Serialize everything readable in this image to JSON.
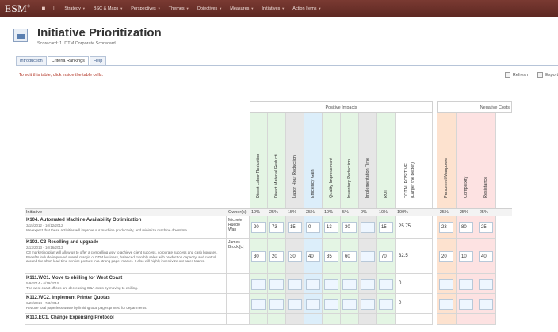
{
  "app": {
    "logo": "ESM",
    "logo_mark": "®",
    "nav": [
      "Strategy",
      "BSC & Maps",
      "Perspectives",
      "Themes",
      "Objectives",
      "Measures",
      "Initiatives",
      "Action Items"
    ]
  },
  "page": {
    "title": "Initiative Prioritization",
    "subtitle": "Scorecard: 1. DTM Corporate Scorecard"
  },
  "tabs": [
    "Introduction",
    "Criteria Rankings",
    "Help"
  ],
  "active_tab": 1,
  "instruction": "To edit this table, click inside the table cells.",
  "toolbar": {
    "refresh": "Refresh",
    "export": "Export"
  },
  "groups": {
    "positive": "Positive Impacts",
    "negative": "Negative Costs"
  },
  "criteria": [
    {
      "label": "Direct Labor Reduction",
      "weight": "10%",
      "color": "#e4f5e4"
    },
    {
      "label": "Direct Material Reducti...",
      "weight": "25%",
      "color": "#e4f5e4"
    },
    {
      "label": "Labor Hour Reduction",
      "weight": "15%",
      "color": "#e6e6e6"
    },
    {
      "label": "Efficiency Gain",
      "weight": "25%",
      "color": "#dceefa"
    },
    {
      "label": "Quality Improvement",
      "weight": "10%",
      "color": "#e4f5e4"
    },
    {
      "label": "Inventory Reduction",
      "weight": "5%",
      "color": "#e4f5e4"
    },
    {
      "label": "Implementation Time",
      "weight": "0%",
      "color": "#e6e6e6"
    },
    {
      "label": "ROI",
      "weight": "10%",
      "color": "#e4f5e4"
    }
  ],
  "total_positive": {
    "line1": "TOTAL POSITIVE",
    "line2": "(Larger the Better)",
    "weight": "100%"
  },
  "negative_criteria": [
    {
      "label": "Personnel/Manpower",
      "weight": "-25%",
      "color": "#fde2cf"
    },
    {
      "label": "Complexity",
      "weight": "-25%",
      "color": "#fde2e2"
    },
    {
      "label": "Resistance",
      "weight": "-25%",
      "color": "#fde2e2"
    }
  ],
  "headers": {
    "initiative": "Initiative",
    "owner": "Owner(s)"
  },
  "rows": [
    {
      "title": "K104. Automated Machine Availability Optimization",
      "date": "3/15/2012 - 10/12/2012",
      "desc": "We expect that these activities will improve our machine productivity, and minimize machine downtime.",
      "owner": [
        "Michele",
        "Ruedo",
        "Wan"
      ],
      "values": [
        "20",
        "73",
        "15",
        "0",
        "13",
        "30",
        "",
        "15"
      ],
      "total": "25.75",
      "neg": [
        "23",
        "80",
        "25"
      ]
    },
    {
      "title": "K102. C3 Reselling and upgrade",
      "date": "2/13/2013 - 10/16/2013",
      "desc": "C3 marketing plan will allow us to offer a compelling way to achieve client success, corporate success and cash bonuses. Benefits include improved overall margin of DTM business, balanced monthly sales with production capacity, and control around the short lead time service posture in a strong paper market. It also will highly incentivize our sales teams.",
      "owner": [
        "James",
        "Brock [c]"
      ],
      "values": [
        "30",
        "20",
        "30",
        "40",
        "35",
        "60",
        "",
        "70"
      ],
      "total": "32.5",
      "neg": [
        "20",
        "10",
        "40"
      ]
    },
    {
      "title": "K111.WC1. Move to ebilling for West Coast",
      "date": "5/9/2014 - 6/19/2015",
      "desc": "The west coast offices are decreasing G&A costs by moving to ebilling.",
      "owner": [],
      "values": [
        "",
        "",
        "",
        "",
        "",
        "",
        "",
        ""
      ],
      "total": "0",
      "neg": [
        "",
        "",
        ""
      ]
    },
    {
      "title": "K112.WC2. Implement Printer Quotas",
      "date": "6/20/2014 - 7/3/2014",
      "desc": "Reduce total paperless waste by limiting total pages printed for departments.",
      "owner": [],
      "values": [
        "",
        "",
        "",
        "",
        "",
        "",
        "",
        ""
      ],
      "total": "0",
      "neg": [
        "",
        "",
        ""
      ]
    },
    {
      "title": "K113.EC1. Change Expensing Protocol",
      "date": "",
      "desc": "",
      "owner": [],
      "values": [
        "",
        "",
        "",
        "",
        "",
        "",
        "",
        ""
      ],
      "total": "",
      "neg": [
        "",
        "",
        ""
      ]
    }
  ]
}
